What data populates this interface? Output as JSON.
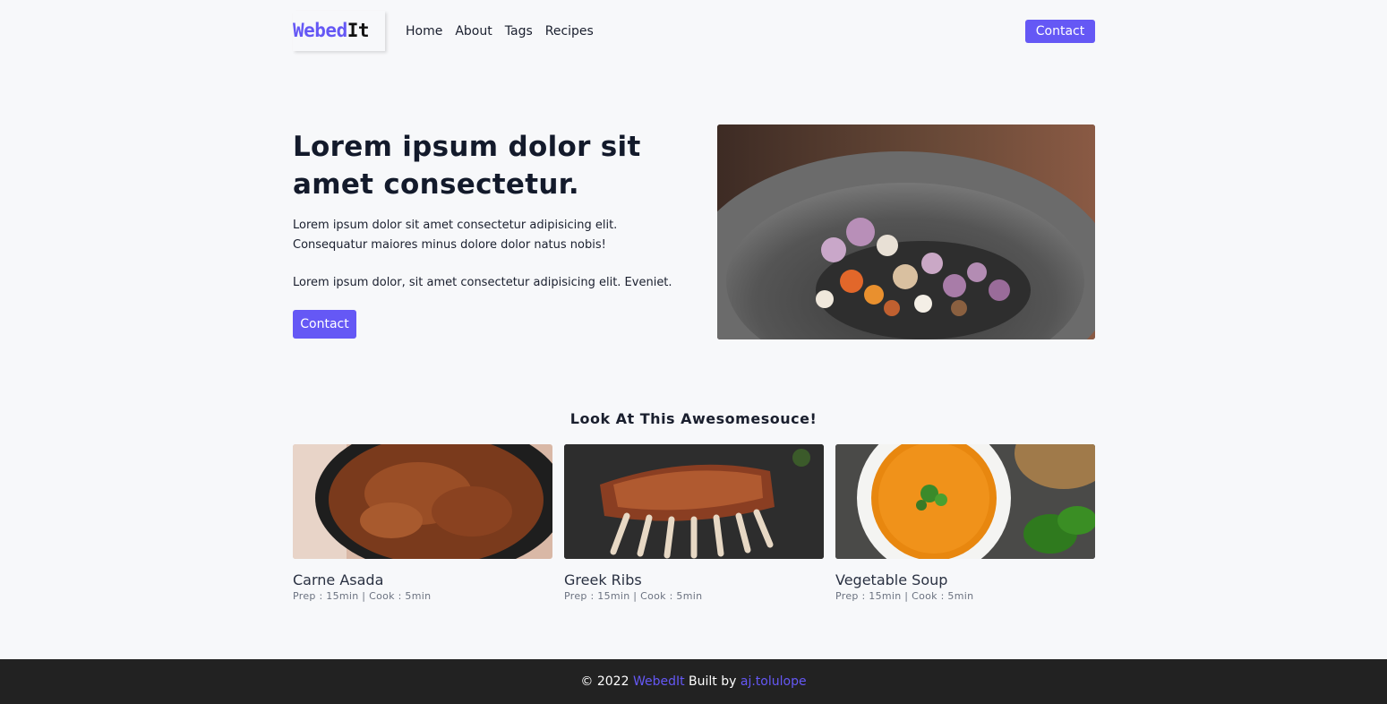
{
  "nav": {
    "logo_part1": "Webed",
    "logo_part2": "It",
    "links": [
      "Home",
      "About",
      "Tags",
      "Recipes"
    ],
    "contact_label": "Contact"
  },
  "hero": {
    "title": "Lorem ipsum dolor sit amet consectetur.",
    "paragraph1": "Lorem ipsum dolor sit amet consectetur adipisicing elit. Consequatur maiores minus dolore dolor natus nobis!",
    "paragraph2": "Lorem ipsum dolor, sit amet consectetur adipisicing elit. Eveniet.",
    "contact_label": "Contact"
  },
  "featured": {
    "title": "Look At This Awesomesouce!",
    "recipes": [
      {
        "name": "Carne Asada",
        "meta": "Prep : 15min | Cook : 5min"
      },
      {
        "name": "Greek Ribs",
        "meta": "Prep : 15min | Cook : 5min"
      },
      {
        "name": "Vegetable Soup",
        "meta": "Prep : 15min | Cook : 5min"
      }
    ]
  },
  "footer": {
    "copyright": "© 2022",
    "brand": "WebedIt",
    "built_by": "Built by",
    "author": "aj.tolulope"
  },
  "colors": {
    "accent": "#6558f5",
    "background": "#f7f8fa",
    "footer_bg": "#222222",
    "text": "#1a1f2e"
  }
}
